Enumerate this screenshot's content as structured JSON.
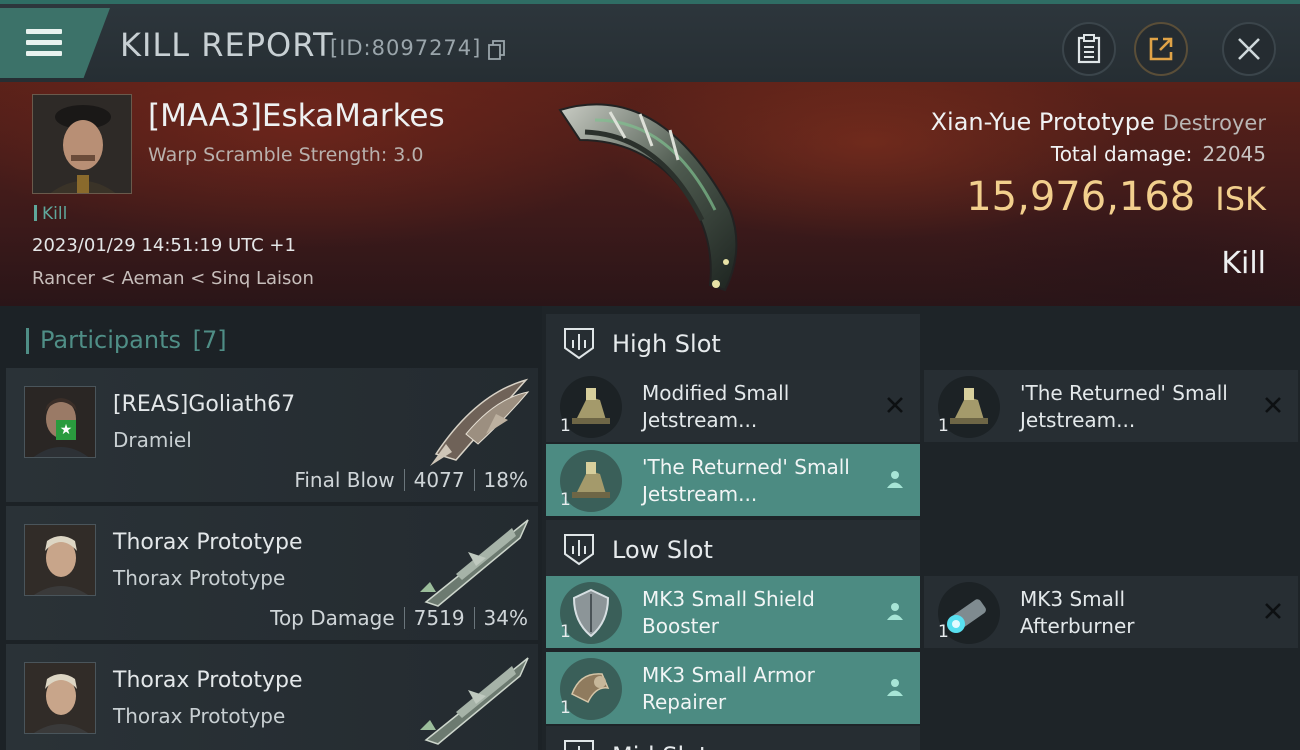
{
  "header": {
    "title": "KILL REPORT",
    "report_id": "[ID:8097274]"
  },
  "victim": {
    "pilot": "[MAA3]EskaMarkes",
    "warp_scramble": "Warp Scramble Strength: 3.0",
    "tag": "Kill",
    "datetime": "2023/01/29 14:51:19 UTC +1",
    "location": "Rancer < Aeman < Sinq Laison",
    "ship": "Xian-Yue Prototype",
    "ship_class": "Destroyer",
    "total_damage_label": "Total damage:",
    "total_damage": "22045",
    "isk_value": "15,976,168",
    "isk_unit": "ISK",
    "result": "Kill"
  },
  "participants": {
    "title": "Participants",
    "count": "[7]",
    "items": [
      {
        "name": "[REAS]Goliath67",
        "ship": "Dramiel",
        "role": "Final Blow",
        "damage": "4077",
        "percent": "18%"
      },
      {
        "name": "Thorax Prototype",
        "ship": "Thorax Prototype",
        "role": "Top Damage",
        "damage": "7519",
        "percent": "34%"
      },
      {
        "name": "Thorax Prototype",
        "ship": "Thorax Prototype",
        "role": "",
        "damage": "",
        "percent": ""
      }
    ]
  },
  "fitting": {
    "high_slot": "High Slot",
    "low_slot": "Low Slot",
    "mid_slot": "Mid Slot",
    "high": [
      {
        "name_line1": "Modified Small",
        "name_line2": "Jetstream...",
        "qty": "1",
        "state": "destroyed"
      },
      {
        "name_line1": "'The Returned' Small",
        "name_line2": "Jetstream...",
        "qty": "1",
        "state": "destroyed"
      },
      {
        "name_line1": "'The Returned' Small",
        "name_line2": "Jetstream...",
        "qty": "1",
        "state": "dropped"
      }
    ],
    "low": [
      {
        "name_line1": "MK3 Small Shield",
        "name_line2": "Booster",
        "qty": "1",
        "state": "dropped"
      },
      {
        "name_line1": "MK3 Small",
        "name_line2": "Afterburner",
        "qty": "1",
        "state": "destroyed"
      },
      {
        "name_line1": "MK3 Small Armor",
        "name_line2": "Repairer",
        "qty": "1",
        "state": "dropped"
      }
    ]
  },
  "colors": {
    "accent_teal": "#4c8b82",
    "isk_gold": "#f2cf8d",
    "banner_red": "#5a2119"
  },
  "icons": [
    "menu-icon",
    "copy-icon",
    "clipboard-icon",
    "share-icon",
    "close-icon",
    "high-slot-icon",
    "low-slot-icon",
    "destroyed-x-icon",
    "dropped-person-icon"
  ]
}
